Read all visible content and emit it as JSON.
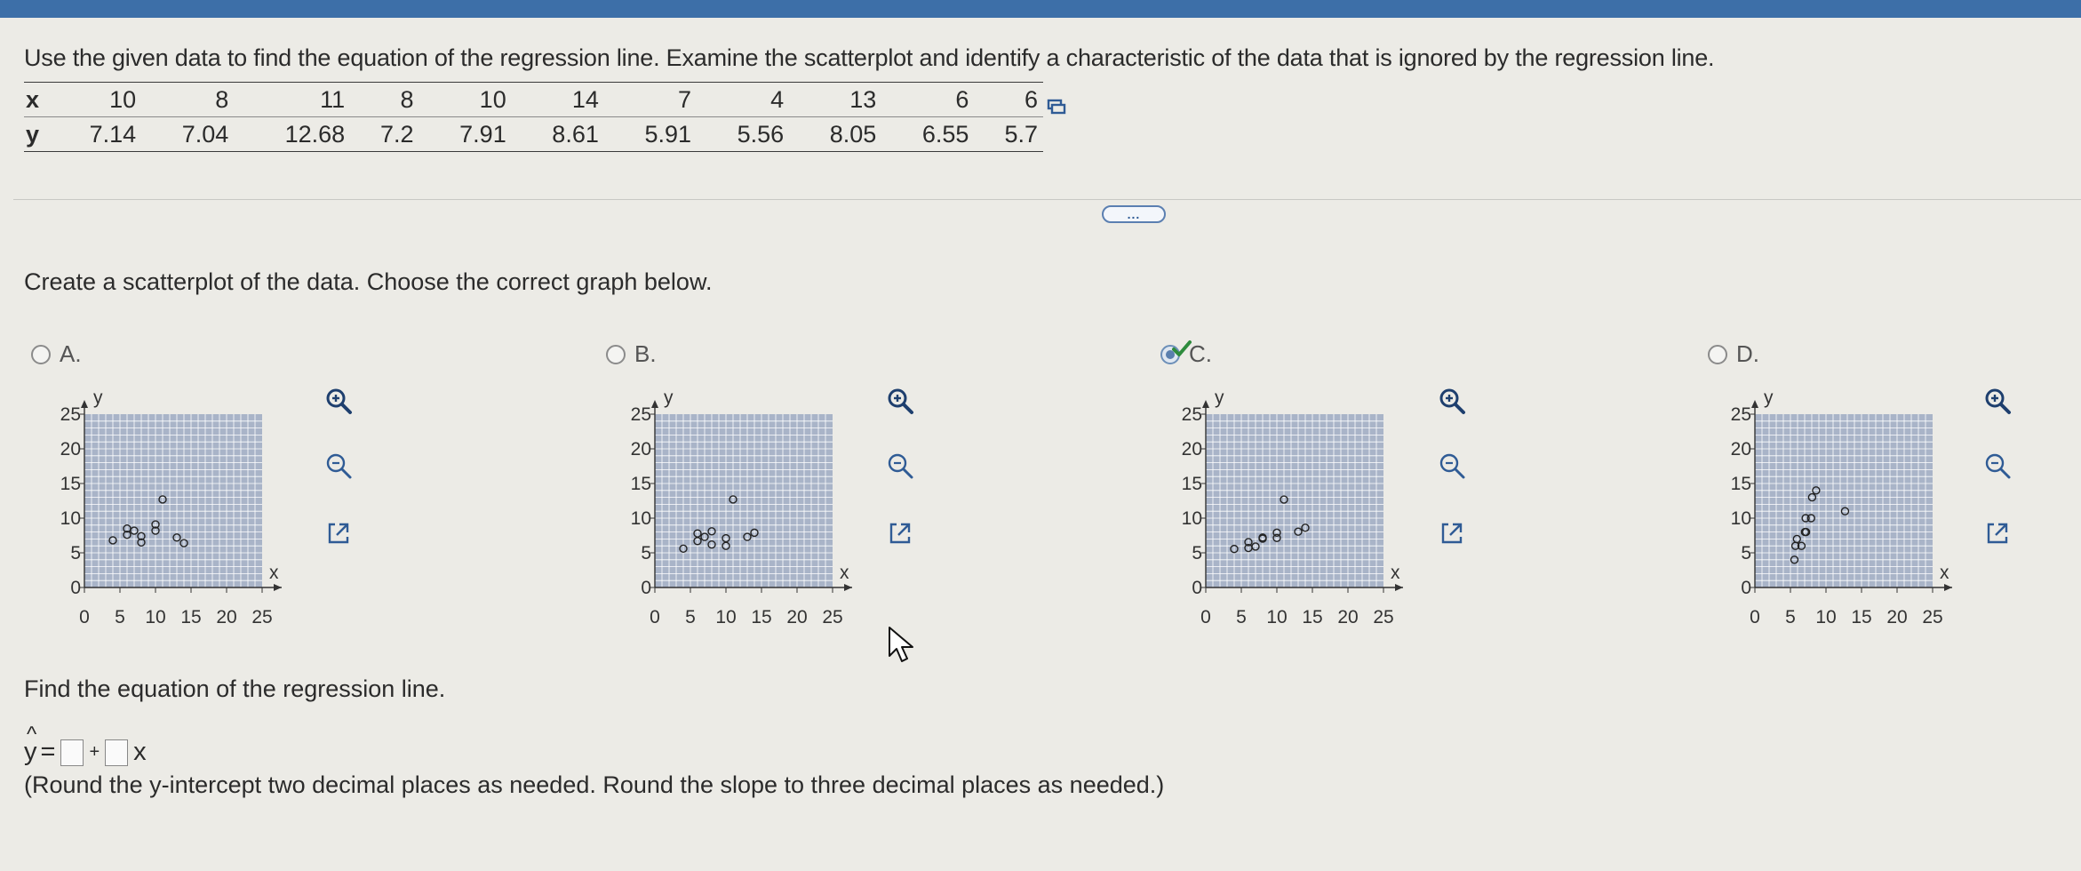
{
  "question": "Use the given data to find the equation of the regression line. Examine the scatterplot and identify a characteristic of the data that is ignored by the regression line.",
  "table": {
    "x_label": "x",
    "y_label": "y",
    "x": [
      "10",
      "8",
      "11",
      "8",
      "10",
      "14",
      "7",
      "4",
      "13",
      "6",
      "6"
    ],
    "y": [
      "7.14",
      "7.04",
      "12.68",
      "7.2",
      "7.91",
      "8.61",
      "5.91",
      "5.56",
      "8.05",
      "6.55",
      "5.7"
    ]
  },
  "prompt": "Create a scatterplot of the data. Choose the correct graph below.",
  "more_label": "...",
  "options": [
    {
      "letter": "A.",
      "selected": false
    },
    {
      "letter": "B.",
      "selected": false
    },
    {
      "letter": "C.",
      "selected": true
    },
    {
      "letter": "D.",
      "selected": false
    }
  ],
  "axis": {
    "y_label": "y",
    "x_label": "x",
    "x_ticks": [
      "0",
      "5",
      "10",
      "15",
      "20",
      "25"
    ],
    "y_ticks": [
      "0",
      "5",
      "10",
      "15",
      "20",
      "25"
    ]
  },
  "chart_data": [
    {
      "type": "scatter",
      "option": "A",
      "xlabel": "x",
      "ylabel": "y",
      "xlim": [
        0,
        25
      ],
      "ylim": [
        0,
        25
      ],
      "points": [
        [
          4,
          6.8
        ],
        [
          6,
          7.6
        ],
        [
          6,
          8.5
        ],
        [
          7,
          8.2
        ],
        [
          8,
          7.4
        ],
        [
          8,
          6.5
        ],
        [
          10,
          8.2
        ],
        [
          10,
          9.1
        ],
        [
          11,
          12.7
        ],
        [
          13,
          7.2
        ],
        [
          14,
          6.4
        ]
      ]
    },
    {
      "type": "scatter",
      "option": "B",
      "xlabel": "x",
      "ylabel": "y",
      "xlim": [
        0,
        25
      ],
      "ylim": [
        0,
        25
      ],
      "points": [
        [
          4,
          5.6
        ],
        [
          6,
          6.7
        ],
        [
          6,
          7.8
        ],
        [
          7,
          7.3
        ],
        [
          8,
          6.2
        ],
        [
          8,
          8.1
        ],
        [
          10,
          7.1
        ],
        [
          10,
          6.0
        ],
        [
          11,
          12.7
        ],
        [
          13,
          7.3
        ],
        [
          14,
          7.9
        ]
      ]
    },
    {
      "type": "scatter",
      "option": "C",
      "xlabel": "x",
      "ylabel": "y",
      "xlim": [
        0,
        25
      ],
      "ylim": [
        0,
        25
      ],
      "points": [
        [
          4,
          5.56
        ],
        [
          6,
          6.55
        ],
        [
          6,
          5.7
        ],
        [
          7,
          5.91
        ],
        [
          8,
          7.04
        ],
        [
          8,
          7.2
        ],
        [
          10,
          7.14
        ],
        [
          10,
          7.91
        ],
        [
          11,
          12.68
        ],
        [
          13,
          8.05
        ],
        [
          14,
          8.61
        ]
      ]
    },
    {
      "type": "scatter",
      "option": "D",
      "xlabel": "x",
      "ylabel": "y",
      "xlim": [
        0,
        25
      ],
      "ylim": [
        0,
        25
      ],
      "points": [
        [
          5.56,
          4
        ],
        [
          6.55,
          6
        ],
        [
          5.7,
          6
        ],
        [
          5.91,
          7
        ],
        [
          7.04,
          8
        ],
        [
          7.2,
          8
        ],
        [
          7.14,
          10
        ],
        [
          7.91,
          10
        ],
        [
          12.68,
          11
        ],
        [
          8.05,
          13
        ],
        [
          8.61,
          14
        ]
      ]
    }
  ],
  "find_text": "Find the equation of the regression line.",
  "equation": {
    "y": "y",
    "hat": "^",
    "equals": "=",
    "plus": "+",
    "x": "x"
  },
  "round_text": "(Round the y-intercept two decimal places as needed. Round the slope to three decimal places as needed.)",
  "icons": [
    "zoom-in-icon",
    "zoom-out-icon",
    "open-external-icon",
    "copy-icon",
    "check-icon",
    "mouse-cursor-icon"
  ],
  "colors": {
    "plot_bg": "#a9b4c8",
    "grid": "#ffffff",
    "accent": "#2f5b95",
    "check": "#2e8b3d"
  }
}
